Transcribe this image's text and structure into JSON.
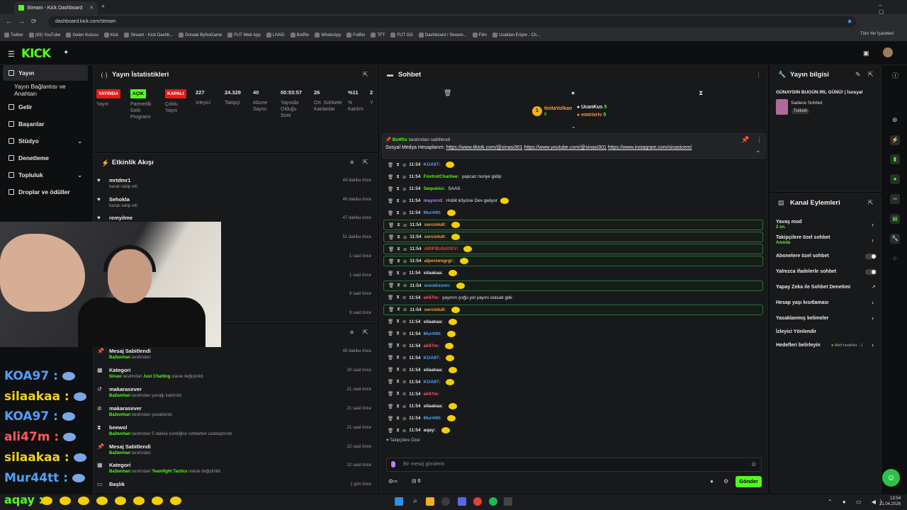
{
  "browser": {
    "tab_title": "Stream - Kick Dashboard",
    "url": "dashboard.kick.com/stream",
    "all_bookmarks": "Tüm Yer İşaretleri",
    "bookmarks": [
      "Twitter",
      "(93) YouTube",
      "Gelen Kutusu",
      "Kick",
      "Stream - Kick Dashb...",
      "Donate ByNoGame",
      "FUT Web App",
      "LIVAD",
      "BotRix",
      "WhatsApp",
      "FutBin",
      "TFT",
      "FUT GG",
      "Dashboard / Stream...",
      "Film",
      "Uzaktan Erişim - Ch..."
    ]
  },
  "sidebar": {
    "items": [
      {
        "label": "Yayın"
      },
      {
        "label": "Yayın Bağlantısı ve Anahtarı"
      },
      {
        "label": "Gelir"
      },
      {
        "label": "Başarılar"
      },
      {
        "label": "Stüdyo"
      },
      {
        "label": "Denetleme"
      },
      {
        "label": "Topluluk"
      },
      {
        "label": "Droplar ve ödüller"
      }
    ]
  },
  "stats": {
    "title": "Yayın İstatistikleri",
    "items": [
      {
        "value": "YAYINDA",
        "label": "Yayın"
      },
      {
        "value": "AÇIK",
        "label": "Partnerlik Gelir Programı"
      },
      {
        "value": "KAPALI",
        "label": "Çoklu Yayın"
      },
      {
        "value": "227",
        "label": "İzleyici"
      },
      {
        "value": "24.329",
        "label": "Takipçi"
      },
      {
        "value": "40",
        "label": "Abone Sayısı"
      },
      {
        "value": "00:53:57",
        "label": "Yayında Olduğu Süre"
      },
      {
        "value": "26",
        "label": "Ort. Sohbete Katılanlar"
      },
      {
        "value": "%11",
        "label": "% Katılım"
      },
      {
        "value": "2",
        "label": "Y"
      }
    ]
  },
  "activity": {
    "title": "Etkinlik Akışı",
    "items": [
      {
        "name": "mrtdmr1",
        "sub": "kanalı takip etti",
        "time": "44 dakika önce"
      },
      {
        "name": "Sehokla",
        "sub": "kanalı takip etti",
        "time": "46 dakika önce"
      },
      {
        "name": "remyilme",
        "sub": "",
        "time": "47 dakika önce"
      },
      {
        "name": "",
        "sub": "",
        "time": "51 dakika önce"
      },
      {
        "name": "",
        "sub": "",
        "time": "1 saat önce"
      },
      {
        "name": "",
        "sub": "",
        "time": "1 saat önce"
      },
      {
        "name": "",
        "sub": "",
        "time": "8 saat önce"
      },
      {
        "name": "",
        "sub": "",
        "time": "9 saat önce"
      }
    ]
  },
  "modlog": {
    "items": [
      {
        "name": "Mesaj Sabitlendi",
        "actor": "Ba2wohan",
        "rest": " tarafından",
        "detail": "",
        "after": "",
        "time": "45 dakika önce"
      },
      {
        "name": "Kategori",
        "actor": "Sinasi",
        "rest": " tarafından ",
        "detail": "Just Chatting",
        "after": " olarak değiştirildi",
        "time": "20 saat önce"
      },
      {
        "name": "makarasever",
        "actor": "Ba2wohan",
        "rest": " tarafından yasağı kaldırıldı",
        "detail": "",
        "after": "",
        "time": "21 saat önce"
      },
      {
        "name": "makarasever",
        "actor": "Ba2wohan",
        "rest": " tarafından yasaklandı",
        "detail": "",
        "after": "",
        "time": "21 saat önce"
      },
      {
        "name": "beewol",
        "actor": "Ba2wohan",
        "rest": " tarafından 5 dakika süreliğine sohbetten uzaklaştırıldı",
        "detail": "",
        "after": "",
        "time": "21 saat önce"
      },
      {
        "name": "Mesaj Sabitlendi",
        "actor": "Ba2wohan",
        "rest": " tarafından",
        "detail": "",
        "after": "",
        "time": "22 saat önce"
      },
      {
        "name": "Kategori",
        "actor": "Ba2wohan",
        "rest": " tarafından ",
        "detail": "Teamfight Tactics",
        "after": " olarak değiştirildi",
        "time": "22 saat önce"
      },
      {
        "name": "Başlık",
        "actor": "",
        "rest": "",
        "detail": "",
        "after": "",
        "time": "1 gün önce"
      }
    ]
  },
  "chat": {
    "title": "Sohbet",
    "top_gifter": {
      "name": "tinitaVolkan",
      "count": "6"
    },
    "gifters": [
      {
        "name": "UcanKus",
        "count": "5"
      },
      {
        "name": "emirivriv",
        "count": "5"
      }
    ],
    "pinned": {
      "by": "BotRix",
      "by_suffix": "tarafından sabitlendi",
      "text": "Sosyal Medya Hesaplarım: ",
      "links": [
        "https://www.tiktok.com/@sinasi301",
        "https://www.youtube.com/@sinasi301",
        "https://www.instagram.com/sinasicem/"
      ]
    },
    "messages": [
      {
        "time": "11:54",
        "user": "KOA97",
        "color": "#4ea1ff",
        "text": "",
        "hl": false,
        "emote": true
      },
      {
        "time": "11:54",
        "user": "FoxtrotCharliee",
        "color": "#53fc18",
        "text": "yapcaz nuriye gidip",
        "hl": false,
        "emote": false
      },
      {
        "time": "11:54",
        "user": "Sequeiss",
        "color": "#53fc18",
        "text": "SAAS",
        "hl": false,
        "emote": false
      },
      {
        "time": "11:54",
        "user": "mayorrd",
        "color": "#c47bff",
        "text": "Hobit köyüne Dev geliyor",
        "hl": false,
        "emote": true
      },
      {
        "time": "11:54",
        "user": "Mur44tt",
        "color": "#4ea1ff",
        "text": "",
        "hl": false,
        "emote": true
      },
      {
        "time": "11:54",
        "user": "sercioluII",
        "color": "#ff9a3c",
        "text": "",
        "hl": true,
        "emote": true
      },
      {
        "time": "11:54",
        "user": "sercioluII",
        "color": "#ff9a3c",
        "text": "",
        "hl": true,
        "emote": true
      },
      {
        "time": "11:54",
        "user": "ARIFBUSAYEV",
        "color": "#ff3b3b",
        "text": "",
        "hl": true,
        "emote": true
      },
      {
        "time": "11:54",
        "user": "alpereengrgr",
        "color": "#ff9a3c",
        "text": "",
        "hl": true,
        "emote": true
      },
      {
        "time": "11:54",
        "user": "silaakaa",
        "color": "#e6e6e6",
        "text": "",
        "hl": false,
        "emote": true
      },
      {
        "time": "11:54",
        "user": "erendixonn",
        "color": "#4ea1ff",
        "text": "",
        "hl": true,
        "emote": true
      },
      {
        "time": "11:54",
        "user": "ali47m",
        "color": "#ff5a5a",
        "text": "yayının çoğu yol yayını olacak gibi",
        "hl": false,
        "emote": false
      },
      {
        "time": "11:54",
        "user": "sercioluII",
        "color": "#ff9a3c",
        "text": "",
        "hl": true,
        "emote": true
      },
      {
        "time": "11:54",
        "user": "silaakaa",
        "color": "#e6e6e6",
        "text": "",
        "hl": false,
        "emote": true
      },
      {
        "time": "11:54",
        "user": "Mur44tt",
        "color": "#4ea1ff",
        "text": "",
        "hl": false,
        "emote": true
      },
      {
        "time": "11:54",
        "user": "ali47m",
        "color": "#ff5a5a",
        "text": "",
        "hl": false,
        "emote": true
      },
      {
        "time": "11:54",
        "user": "KOA97",
        "color": "#4ea1ff",
        "text": "",
        "hl": false,
        "emote": true
      },
      {
        "time": "11:54",
        "user": "silaakaa",
        "color": "#e6e6e6",
        "text": "",
        "hl": false,
        "emote": true
      },
      {
        "time": "11:54",
        "user": "KOA97",
        "color": "#4ea1ff",
        "text": "",
        "hl": false,
        "emote": true
      },
      {
        "time": "11:54",
        "user": "ali47m",
        "color": "#ff5a5a",
        "text": "",
        "hl": false,
        "emote": false
      },
      {
        "time": "11:54",
        "user": "silaakaa",
        "color": "#e6e6e6",
        "text": "",
        "hl": false,
        "emote": true
      },
      {
        "time": "11:54",
        "user": "Mur44tt",
        "color": "#4ea1ff",
        "text": "",
        "hl": false,
        "emote": true
      },
      {
        "time": "11:54",
        "user": "aqay",
        "color": "#e6e6e6",
        "text": "",
        "hl": false,
        "emote": true
      }
    ],
    "followers_only_label": "Takipçilere Özel",
    "input_placeholder": "Bir mesaj gönderin",
    "points": "0",
    "send": "Gönder"
  },
  "info": {
    "title": "Yayın bilgisi",
    "stream_title": "GÜNAYDIN BUGÜN IRL GÜNÜ! | İsosyal",
    "category": "Sadece Sohbet",
    "tag": "Turkish"
  },
  "channel": {
    "title": "Kanal Eylemleri",
    "actions": [
      {
        "label": "Yavaş mod",
        "sub": "2 sn."
      },
      {
        "label": "Takipçilere özel sohbet",
        "sub": "Anında"
      },
      {
        "label": "Abonelere özel sohbet",
        "sub": ""
      },
      {
        "label": "Yalnızca ifadelerle sohbet",
        "sub": ""
      },
      {
        "label": "Yapay Zeka ile Sohbet Denetimi",
        "sub": ""
      },
      {
        "label": "Hesap yaşı kısıtlaması",
        "sub": ""
      },
      {
        "label": "Yasaklanmış kelimeler",
        "sub": ""
      },
      {
        "label": "İzleyici Yönlendir",
        "sub": ""
      },
      {
        "label": "Hedefleri belirleyin",
        "sub": ""
      }
    ],
    "goals_active": "Aktif hedefler - 1"
  },
  "overlay": {
    "names": [
      "KOA97 :",
      "silaakaa :",
      "KOA97 :",
      "ali47m :",
      "silaakaa :",
      "Mur44tt :"
    ],
    "colors": [
      "#4ea1ff",
      "#f2d21b",
      "#4ea1ff",
      "#ff5a5a",
      "#f2d21b",
      "#4ea1ff"
    ],
    "bottom": "aqay :"
  },
  "taskbar": {
    "time": "13:54",
    "date": "21.04.2026"
  },
  "colors": {
    "accent": "#53fc18",
    "live": "#e91916",
    "on": "#53fc18",
    "off": "#e91916"
  }
}
